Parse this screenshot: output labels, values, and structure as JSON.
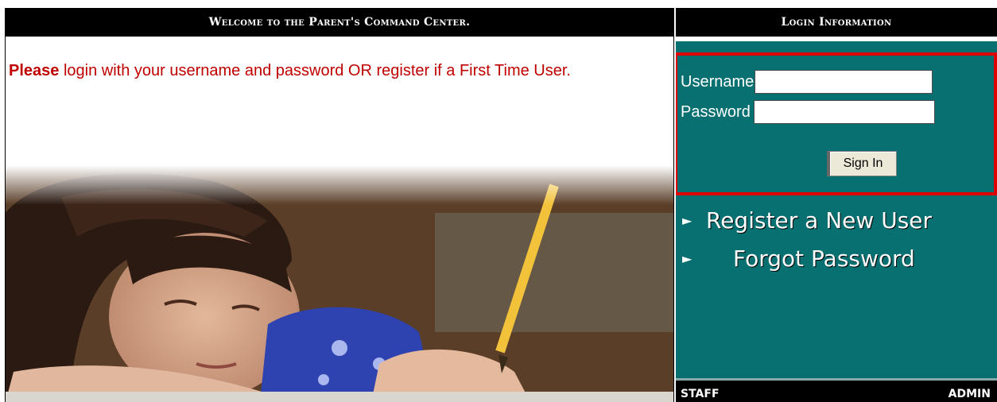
{
  "left": {
    "header": "Welcome to the Parent's Command Center.",
    "intro_strong": "Please",
    "intro_text": " login with your username and password OR register if a First Time User."
  },
  "right": {
    "header": "Login Information",
    "username_label": "Username",
    "password_label": "Password",
    "username_value": "",
    "password_value": "",
    "signin_label": "Sign In",
    "register_link": "Register a New User",
    "forgot_link": "Forgot Password",
    "arrow_glyph": "►",
    "footer_left": "STAFF",
    "footer_right": "ADMIN"
  },
  "colors": {
    "panel_teal": "#087070",
    "highlight_red": "#e00000",
    "intro_red": "#c00000"
  }
}
